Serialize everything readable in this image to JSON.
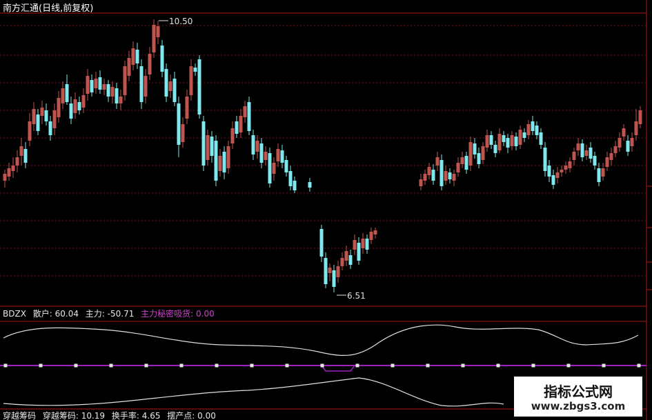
{
  "header": {
    "title": "南方汇通(日线,前复权)"
  },
  "price_panel": {
    "high_label": "10.50",
    "low_label": "6.51",
    "colors": {
      "up": "#c0544e",
      "down": "#7ee8ee",
      "grid": "#7a1010",
      "frame": "#b01818"
    }
  },
  "indicator_panel": {
    "name": "BDZX",
    "items": [
      {
        "label": "散户: 60.04",
        "color": "#e8e8e8"
      },
      {
        "label": "主力: -50.71",
        "color": "#e8e8e8"
      },
      {
        "label": "主力秘密吸货: 0.00",
        "color": "#d040d0"
      }
    ],
    "line_color": "#e0e0e0",
    "marker_color": "#a020c0"
  },
  "bottom_panel": {
    "items": [
      {
        "label": "穿越筹码",
        "color": "#e8e8e8"
      },
      {
        "label": "穿越筹码: 10.19",
        "color": "#e8e8e8"
      },
      {
        "label": "换手率: 4.65",
        "color": "#e8e8e8"
      },
      {
        "label": "摆产点: 0.00",
        "color": "#e8e8e8"
      }
    ]
  },
  "watermark": {
    "line1": "指标公式网",
    "line2": "www.zbgs3.com"
  }
}
